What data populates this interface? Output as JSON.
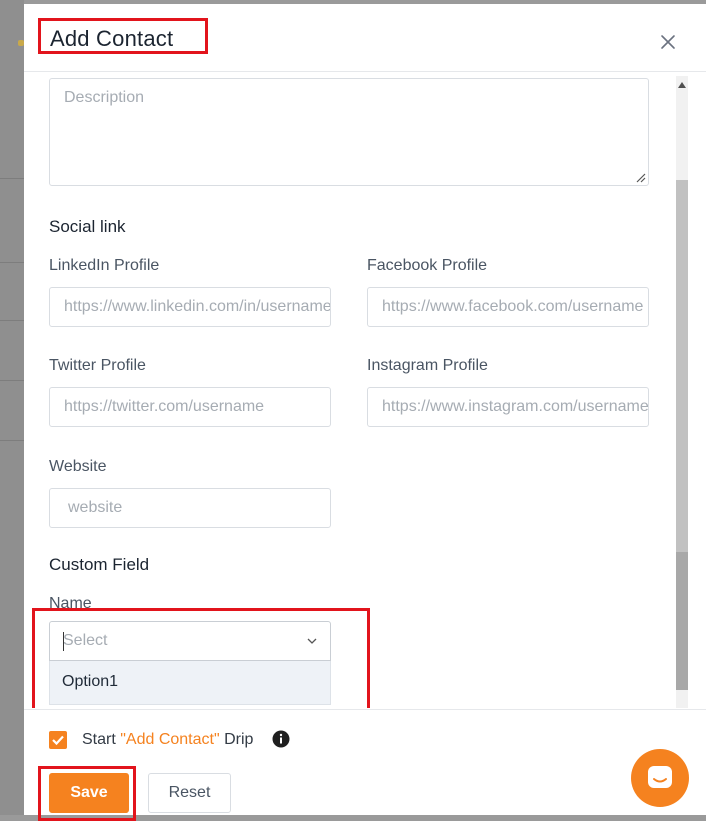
{
  "modal": {
    "title": "Add Contact"
  },
  "description": {
    "placeholder": "Description"
  },
  "social": {
    "section_title": "Social link",
    "linkedin_label": "LinkedIn Profile",
    "linkedin_placeholder": "https://www.linkedin.com/in/username",
    "facebook_label": "Facebook Profile",
    "facebook_placeholder": "https://www.facebook.com/username",
    "twitter_label": "Twitter Profile",
    "twitter_placeholder": "https://twitter.com/username",
    "instagram_label": "Instagram Profile",
    "instagram_placeholder": "https://www.instagram.com/username",
    "website_label": "Website",
    "website_placeholder": "website"
  },
  "custom_field": {
    "section_title": "Custom Field",
    "name_label": "Name",
    "select_placeholder": "Select",
    "options": [
      "Option1"
    ]
  },
  "footer": {
    "drip_prefix": "Start ",
    "drip_accent": "\"Add Contact\"",
    "drip_suffix": " Drip",
    "drip_checked": true,
    "save_label": "Save",
    "reset_label": "Reset"
  },
  "colors": {
    "accent": "#f5821f",
    "highlight": "#e2141c"
  },
  "icons": {
    "close": "close-icon",
    "chevron": "chevron-down-icon",
    "info": "info-icon",
    "chat": "chat-icon",
    "check": "check-icon"
  }
}
